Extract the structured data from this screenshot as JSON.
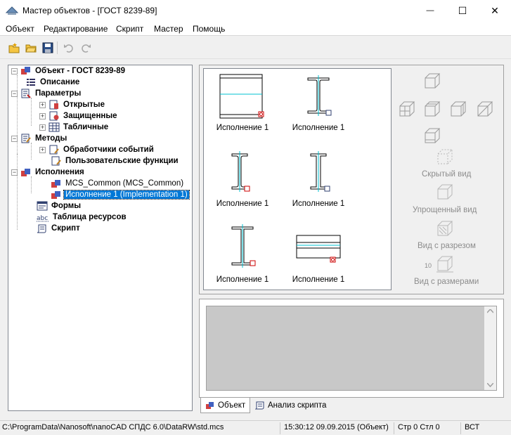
{
  "window": {
    "title": "Мастер объектов - [ГОСТ 8239-89]",
    "minimize_glyph": "—",
    "maximize_glyph": "☐",
    "close_glyph": "✕"
  },
  "menu": [
    "Объект",
    "Редактирование",
    "Скрипт",
    "Мастер",
    "Помощь"
  ],
  "toolbar": {
    "buttons": [
      "new-object-icon",
      "open-folder-icon",
      "save-icon",
      "undo-icon",
      "redo-icon"
    ]
  },
  "tree": {
    "expander_glyph": "−",
    "collapsed_glyph": "+",
    "root": "Объект - ГОСТ 8239-89",
    "description": "Описание",
    "parameters": "Параметры",
    "open": "Открытые",
    "protected": "Защищенные",
    "tabular": "Табличные",
    "methods": "Методы",
    "event_handlers": "Обработчики событий",
    "user_functions": "Пользовательские функции",
    "implementations": "Исполнения",
    "mcs_common": "MCS_Common (MCS_Common)",
    "impl1": "Исполнение 1 (Implementation 1)",
    "forms": "Формы",
    "resources": "Таблица ресурсов",
    "script": "Скрипт"
  },
  "gallery": {
    "captions": [
      "Исполнение 1",
      "Исполнение 1",
      "Исполнение 1",
      "Исполнение 1",
      "Исполнение 1",
      "Исполнение 1"
    ]
  },
  "views": {
    "hidden": "Скрытый вид",
    "simplified": "Упрощенный вид",
    "section": "Вид с разрезом",
    "dimensions": "Вид с размерами",
    "dim_number": "10"
  },
  "tabs": {
    "object": "Объект",
    "script_analysis": "Анализ скрипта"
  },
  "status": {
    "path": "C:\\ProgramData\\Nanosoft\\nanoCAD СПДС 6.0\\DataRW\\std.mcs",
    "time": "15:30:12  09.09.2015  (Объект)",
    "position": "Стр 0 Стл 0",
    "mode": "ВСТ"
  },
  "colors": {
    "selection": "#0078d7",
    "accent_line": "#00c0d0",
    "disabled_text": "#8c8c8c"
  }
}
